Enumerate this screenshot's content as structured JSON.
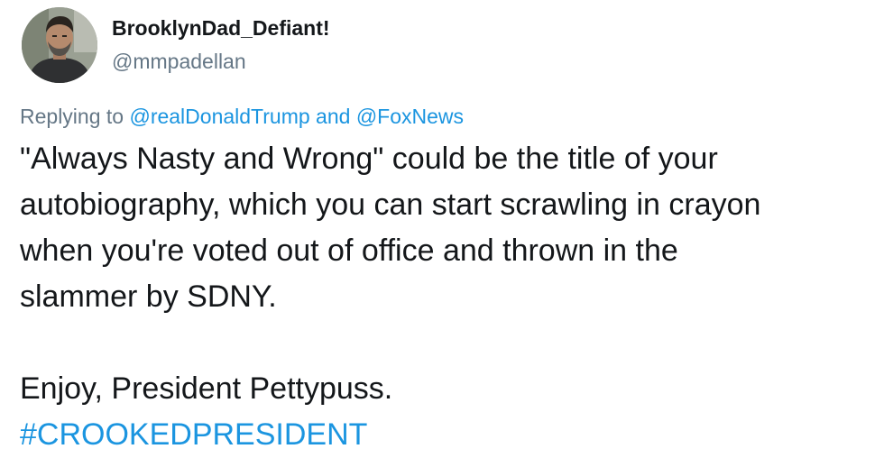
{
  "tweet": {
    "display_name": "BrooklynDad_Defiant!",
    "handle": "@mmpadellan",
    "replying_to_prefix": "Replying to",
    "reply_mention_1": "@realDonaldTrump",
    "reply_and": "and",
    "reply_mention_2": "@FoxNews",
    "body_lines": [
      "\"Always Nasty and Wrong\" could be the title of your",
      "autobiography, which you can start scrawling in crayon",
      "when you're voted out of office and thrown in the",
      "slammer by SDNY."
    ],
    "closing_line": "Enjoy, President Pettypuss.",
    "hashtag": "#CROOKEDPRESIDENT"
  },
  "colors": {
    "link": "#1b95e0",
    "secondary_text": "#657786",
    "primary_text": "#14171a"
  },
  "icons": {
    "avatar": "user-photo-avatar"
  }
}
